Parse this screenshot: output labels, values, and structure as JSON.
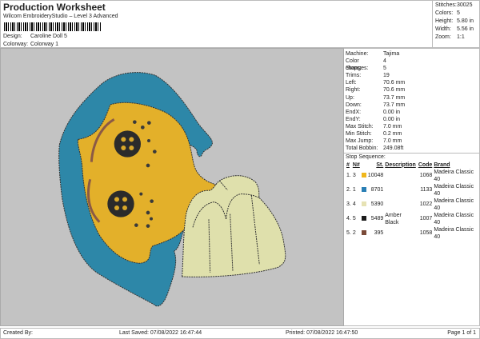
{
  "header": {
    "title": "Production Worksheet",
    "subtitle": "Wilcom EmbroideryStudio – Level 3 Advanced",
    "design_label": "Design:",
    "design": "Caroline Doll 5",
    "colorway_label": "Colorway:",
    "colorway": "Colorway 1"
  },
  "stats": [
    {
      "k": "Stitches:",
      "v": "30025"
    },
    {
      "k": "Colors:",
      "v": "5"
    },
    {
      "k": "Height:",
      "v": "5.80 in"
    },
    {
      "k": "Width:",
      "v": "5.56 in"
    },
    {
      "k": "Zoom:",
      "v": "1:1"
    }
  ],
  "info": [
    {
      "k": "Machine:",
      "v": "Tajima"
    },
    {
      "k": "Color changes:",
      "v": "4"
    },
    {
      "k": "Stops:",
      "v": "5"
    },
    {
      "k": "Trims:",
      "v": "19"
    },
    {
      "k": "Left:",
      "v": "70.6 mm"
    },
    {
      "k": "Right:",
      "v": "70.6 mm"
    },
    {
      "k": "Up:",
      "v": "73.7 mm"
    },
    {
      "k": "Down:",
      "v": "73.7 mm"
    },
    {
      "k": "EndX:",
      "v": "0.00 in"
    },
    {
      "k": "EndY:",
      "v": "0.00 in"
    },
    {
      "k": "Max Stitch:",
      "v": "7.0 mm"
    },
    {
      "k": "Min Stitch:",
      "v": "0.2 mm"
    },
    {
      "k": "Max Jump:",
      "v": "7.0 mm"
    },
    {
      "k": "Total Bobbin:",
      "v": "249.08ft"
    }
  ],
  "stop_sequence": {
    "title": "Stop Sequence:",
    "headers": [
      "#",
      "N#",
      "",
      "St.",
      "Description",
      "Code",
      "Brand"
    ],
    "rows": [
      {
        "n": "1.",
        "nn": "3",
        "color": "#f0b71c",
        "st": "10048",
        "desc": "",
        "code": "1068",
        "brand": "Madeira Classic 40"
      },
      {
        "n": "2.",
        "nn": "1",
        "color": "#2a7fb5",
        "st": "8701",
        "desc": "",
        "code": "1133",
        "brand": "Madeira Classic 40"
      },
      {
        "n": "3.",
        "nn": "4",
        "color": "#e6e2b4",
        "st": "5390",
        "desc": "",
        "code": "1022",
        "brand": "Madeira Classic 40"
      },
      {
        "n": "4.",
        "nn": "5",
        "color": "#1b1b1b",
        "st": "5489",
        "desc": "Amber Black",
        "code": "1007",
        "brand": "Madeira Classic 40"
      },
      {
        "n": "5.",
        "nn": "2",
        "color": "#7a4a38",
        "st": "395",
        "desc": "",
        "code": "1058",
        "brand": "Madeira Classic 40"
      }
    ]
  },
  "footer": {
    "created": "Created By:",
    "saved": "Last Saved: 07/08/2022 16:47:44",
    "printed": "Printed: 07/08/2022 16:47:50",
    "page": "Page 1 of 1"
  }
}
